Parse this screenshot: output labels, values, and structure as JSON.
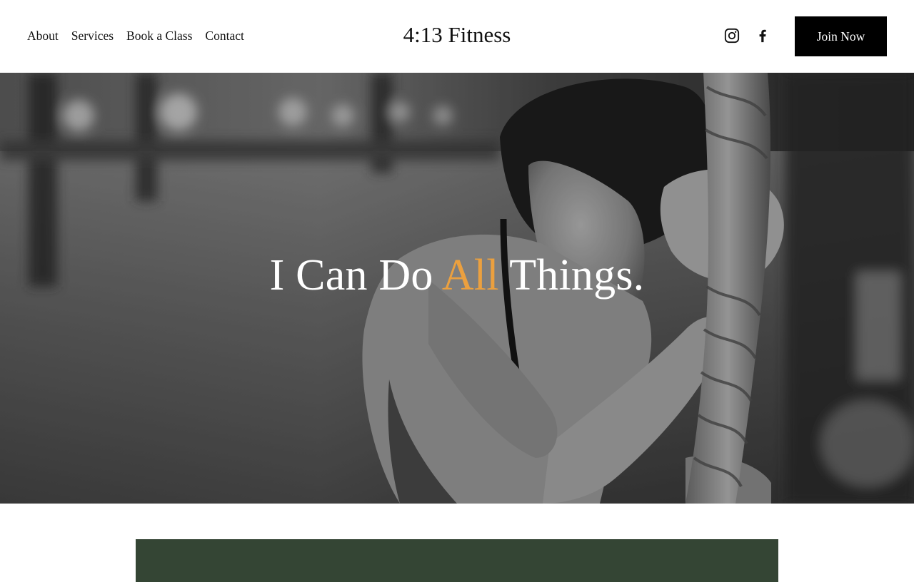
{
  "header": {
    "nav": [
      {
        "label": "About"
      },
      {
        "label": "Services"
      },
      {
        "label": "Book a Class"
      },
      {
        "label": "Contact"
      }
    ],
    "site_title": "4:13 Fitness",
    "social": [
      {
        "icon": "instagram-icon"
      },
      {
        "icon": "facebook-icon"
      }
    ],
    "cta_label": "Join Now"
  },
  "hero": {
    "heading_before": "I Can Do ",
    "heading_accent": "All",
    "heading_after": " Things.",
    "accent_color": "#eba03f",
    "image": "black-and-white photo of a woman resting her head against a climbing rope in a gym"
  },
  "section": {
    "panel_color": "#344534"
  },
  "colors": {
    "cta_background": "#000000",
    "text": "#111111"
  }
}
